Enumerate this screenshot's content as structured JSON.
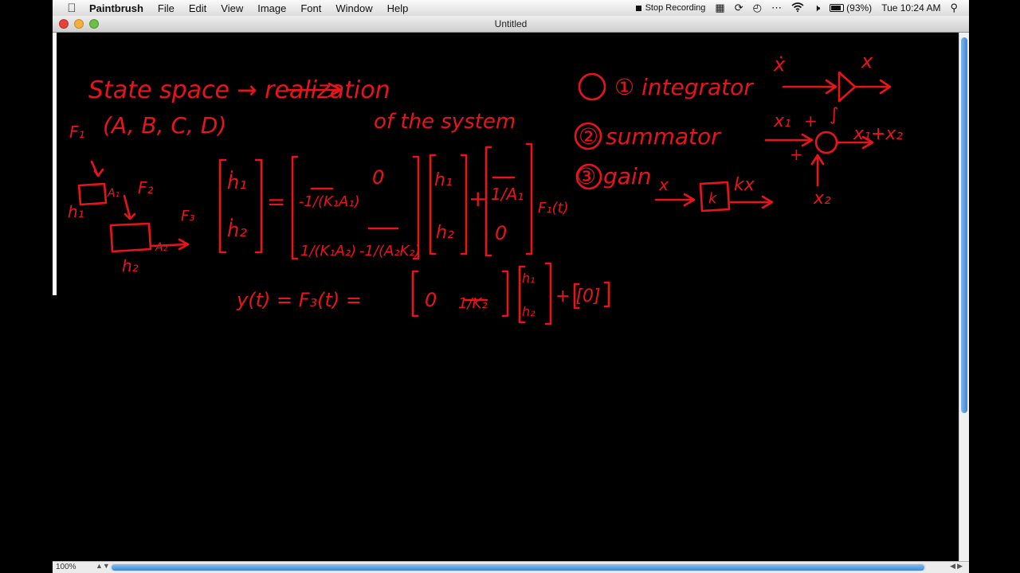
{
  "menubar": {
    "app_name": "Paintbrush",
    "menus": [
      "File",
      "Edit",
      "View",
      "Image",
      "Font",
      "Window",
      "Help"
    ],
    "stop_recording": "Stop Recording",
    "battery": "(93%)",
    "clock": "Tue 10:24 AM",
    "icons": [
      "apple-icon",
      "screen-recorder-icon",
      "display-mirror-icon",
      "sync-icon",
      "time-machine-icon",
      "more-icon",
      "wifi-icon",
      "volume-icon",
      "battery-icon",
      "spotlight-search-icon"
    ]
  },
  "window": {
    "title": "Untitled",
    "zoom_level": "100%"
  },
  "drawing": {
    "ink_color": "#e8141c",
    "heading_left": "State space → realization",
    "heading_left_2": "(A, B, C, D)",
    "heading_left_3": "of the system",
    "list_items": [
      "① integrator",
      "② summator",
      "③ gain"
    ],
    "integrator_labels": [
      "ẋ",
      "x",
      "∫"
    ],
    "summator_labels": [
      "x₁",
      "+",
      "+",
      "x₁+x₂",
      "x₂"
    ],
    "gain_labels": [
      "x",
      "k",
      "kx"
    ],
    "tank_labels": [
      "F₁",
      "h₁",
      "F₂",
      "F₃",
      "h₂",
      "A₁",
      "A₂"
    ],
    "state_equation": {
      "lhs": [
        "ḣ₁",
        "ḣ₂"
      ],
      "A_matrix": [
        [
          "-1/(K₁A₁)",
          "0"
        ],
        [
          "1/(K₁A₂)",
          "-1/(A₂K₂)"
        ]
      ],
      "state_vector": [
        "h₁",
        "h₂"
      ],
      "B_matrix": [
        "1/A₁",
        "0"
      ],
      "input": "F₁(t)"
    },
    "output_equation": {
      "lhs": "y(t) = F₃(t) =",
      "C_matrix": [
        "0",
        "1/K₂"
      ],
      "state_vector": [
        "h₁",
        "h₂"
      ],
      "D_matrix": "+ [0]"
    }
  }
}
